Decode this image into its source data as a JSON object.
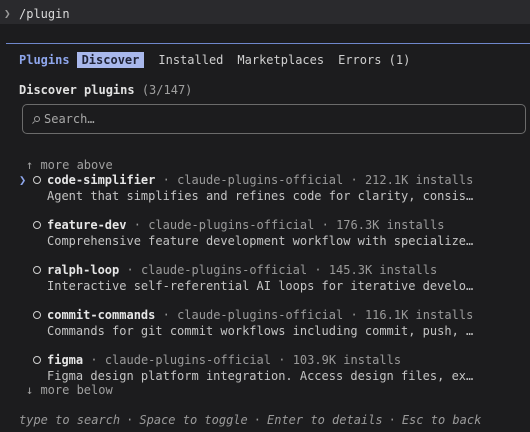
{
  "command_bar": {
    "prompt": "❯",
    "text": "/plugin"
  },
  "tabs": {
    "title": "Plugins",
    "items": [
      {
        "label": "Discover",
        "active": true
      },
      {
        "label": "Installed",
        "active": false
      },
      {
        "label": "Marketplaces",
        "active": false
      },
      {
        "label": "Errors (1)",
        "active": false
      }
    ]
  },
  "section": {
    "title": "Discover plugins",
    "count": "(3/147)"
  },
  "search": {
    "icon": "search-icon",
    "placeholder": "Search…"
  },
  "more_above": "↑ more above",
  "more_below": "↓ more below",
  "plugins": [
    {
      "name": "code-simplifier",
      "marketplace": "claude-plugins-official",
      "installs": "212.1K installs",
      "description": "Agent that simplifies and refines code for clarity, consist…",
      "selected": true
    },
    {
      "name": "feature-dev",
      "marketplace": "claude-plugins-official",
      "installs": "176.3K installs",
      "description": "Comprehensive feature development workflow with specialized…",
      "selected": false
    },
    {
      "name": "ralph-loop",
      "marketplace": "claude-plugins-official",
      "installs": "145.3K installs",
      "description": "Interactive self-referential AI loops for iterative develop…",
      "selected": false
    },
    {
      "name": "commit-commands",
      "marketplace": "claude-plugins-official",
      "installs": "116.1K installs",
      "description": "Commands for git commit workflows including commit, push, a…",
      "selected": false
    },
    {
      "name": "figma",
      "marketplace": "claude-plugins-official",
      "installs": "103.9K installs",
      "description": "Figma design platform integration. Access design files, ext…",
      "selected": false
    }
  ],
  "separator": "·",
  "pointer": "❯",
  "footer": {
    "hints": [
      "type to search",
      "Space to toggle",
      "Enter to details",
      "Esc to back"
    ]
  },
  "colors": {
    "background": "#1c1c1e",
    "accent": "#8ea6ec",
    "active_tab": "#a9b8ec",
    "rule": "#6f87cc"
  }
}
